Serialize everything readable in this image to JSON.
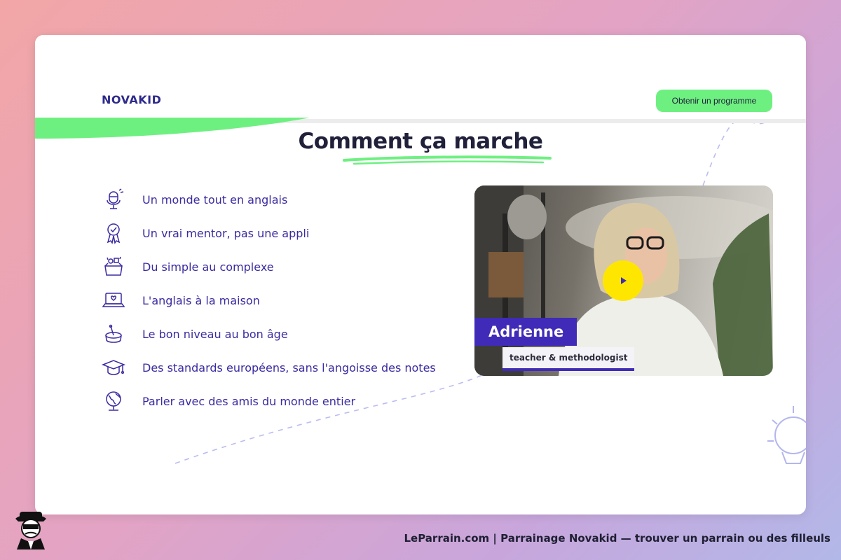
{
  "header": {
    "logo_text": "NOVAKID",
    "cta_label": "Obtenir un programme"
  },
  "main": {
    "title": "Comment ça marche",
    "features": [
      {
        "icon": "microphone-icon",
        "label": "Un monde tout en anglais"
      },
      {
        "icon": "medal-icon",
        "label": "Un vrai mentor, pas une appli"
      },
      {
        "icon": "toy-box-icon",
        "label": "Du simple au complexe"
      },
      {
        "icon": "laptop-icon",
        "label": "L'anglais à la maison"
      },
      {
        "icon": "pot-icon",
        "label": "Le bon niveau au bon âge"
      },
      {
        "icon": "graduation-cap-icon",
        "label": "Des standards européens, sans l'angoisse des notes"
      },
      {
        "icon": "globe-icon",
        "label": "Parler avec des amis du monde entier"
      }
    ],
    "video": {
      "name": "Adrienne",
      "role": "teacher & methodologist",
      "play_icon": "play-icon"
    }
  },
  "footer": {
    "text": "LeParrain.com | Parrainage Novakid — trouver un parrain ou des filleuls",
    "mascot_icon": "mascot-icon"
  },
  "colors": {
    "brand": "#2d2a8c",
    "accent_green": "#6ef081",
    "text_purple": "#3a2ba0",
    "play_yellow": "#ffe600",
    "tag_purple": "#3f2bb8"
  }
}
